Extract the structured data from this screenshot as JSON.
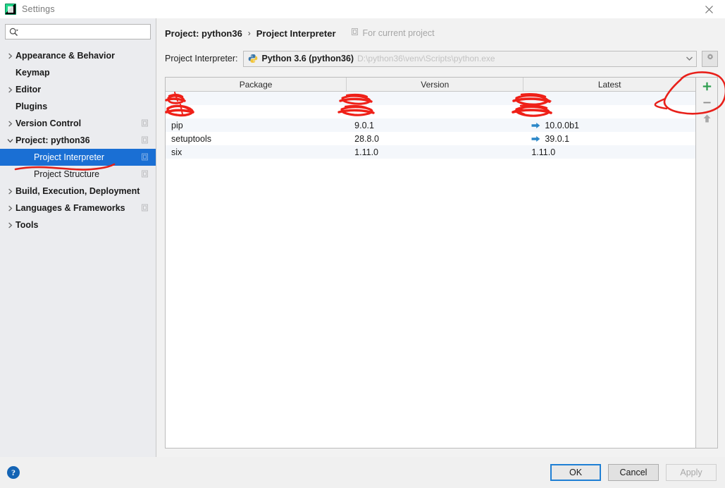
{
  "window": {
    "title": "Settings",
    "app_icon": "pycharm-icon",
    "close_label": "close-icon"
  },
  "sidebar": {
    "search": {
      "placeholder": "",
      "value": "",
      "icon": "search-icon"
    },
    "items": [
      {
        "label": "Appearance & Behavior",
        "expandable": true,
        "expanded": false,
        "bold": true,
        "child": false,
        "copy": false,
        "selected": false
      },
      {
        "label": "Keymap",
        "expandable": false,
        "expanded": false,
        "bold": true,
        "child": false,
        "copy": false,
        "selected": false
      },
      {
        "label": "Editor",
        "expandable": true,
        "expanded": false,
        "bold": true,
        "child": false,
        "copy": false,
        "selected": false
      },
      {
        "label": "Plugins",
        "expandable": false,
        "expanded": false,
        "bold": true,
        "child": false,
        "copy": false,
        "selected": false
      },
      {
        "label": "Version Control",
        "expandable": true,
        "expanded": false,
        "bold": true,
        "child": false,
        "copy": true,
        "selected": false
      },
      {
        "label": "Project: python36",
        "expandable": true,
        "expanded": true,
        "bold": true,
        "child": false,
        "copy": true,
        "selected": false
      },
      {
        "label": "Project Interpreter",
        "expandable": false,
        "expanded": false,
        "bold": false,
        "child": true,
        "copy": true,
        "selected": true
      },
      {
        "label": "Project Structure",
        "expandable": false,
        "expanded": false,
        "bold": false,
        "child": true,
        "copy": true,
        "selected": false
      },
      {
        "label": "Build, Execution, Deployment",
        "expandable": true,
        "expanded": false,
        "bold": true,
        "child": false,
        "copy": false,
        "selected": false
      },
      {
        "label": "Languages & Frameworks",
        "expandable": true,
        "expanded": false,
        "bold": true,
        "child": false,
        "copy": true,
        "selected": false
      },
      {
        "label": "Tools",
        "expandable": true,
        "expanded": false,
        "bold": true,
        "child": false,
        "copy": false,
        "selected": false
      }
    ]
  },
  "main": {
    "breadcrumb": {
      "root": "Project: python36",
      "separator": "›",
      "current": "Project Interpreter",
      "note": "For current project",
      "note_icon": "copy-icon"
    },
    "interpreter": {
      "label": "Project Interpreter:",
      "icon": "python-icon",
      "name": "Python 3.6 (python36)",
      "path": "D:\\python36\\venv\\Scripts\\python.exe",
      "dropdown_icon": "chevron-down-icon",
      "gear_icon": "gear-icon"
    },
    "table": {
      "columns": [
        "Package",
        "Version",
        "Latest"
      ],
      "rows": [
        {
          "package": "",
          "version": "",
          "latest": "",
          "upgradable": false,
          "obscured": true
        },
        {
          "package": "",
          "version": "",
          "latest": "",
          "upgradable": false,
          "obscured": true
        },
        {
          "package": "pip",
          "version": "9.0.1",
          "latest": "10.0.0b1",
          "upgradable": true,
          "obscured": false
        },
        {
          "package": "setuptools",
          "version": "28.8.0",
          "latest": "39.0.1",
          "upgradable": true,
          "obscured": false
        },
        {
          "package": "six",
          "version": "1.11.0",
          "latest": "1.11.0",
          "upgradable": false,
          "obscured": false
        }
      ]
    },
    "side_tools": [
      {
        "name": "add-package-button",
        "icon": "plus-icon",
        "color": "#2e9e4f"
      },
      {
        "name": "remove-package-button",
        "icon": "minus-icon",
        "color": "#8c8c8c"
      },
      {
        "name": "upgrade-package-button",
        "icon": "arrow-up-icon",
        "color": "#a0a0a0"
      }
    ]
  },
  "footer": {
    "help_label": "?",
    "ok_label": "OK",
    "cancel_label": "Cancel",
    "apply_label": "Apply"
  },
  "annotations": {
    "accent_color": "#e8201a",
    "circle_target": "add-remove-package-buttons",
    "underline_target": "sidebar-item-project-interpreter",
    "scribble_targets": [
      "table-row-0",
      "table-row-1"
    ]
  }
}
